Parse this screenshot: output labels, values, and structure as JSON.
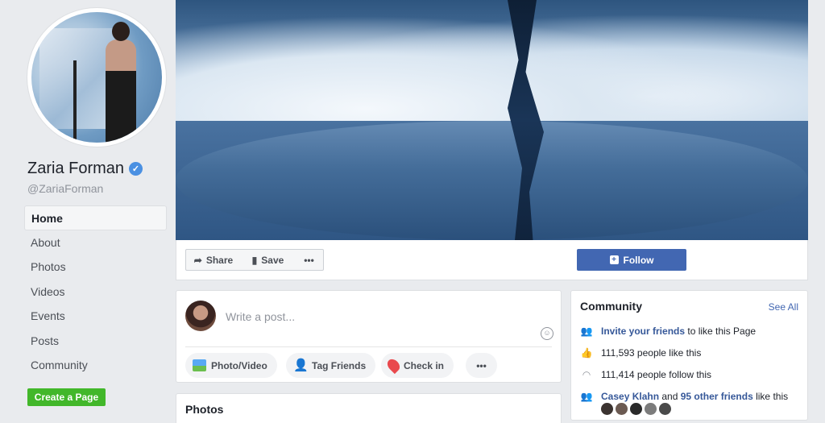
{
  "profile": {
    "name": "Zaria Forman",
    "handle": "@ZariaForman"
  },
  "nav": {
    "items": [
      {
        "label": "Home"
      },
      {
        "label": "About"
      },
      {
        "label": "Photos"
      },
      {
        "label": "Videos"
      },
      {
        "label": "Events"
      },
      {
        "label": "Posts"
      },
      {
        "label": "Community"
      }
    ],
    "active": "Home"
  },
  "create_page_label": "Create a Page",
  "actions": {
    "share_label": "Share",
    "save_label": "Save",
    "more_label": "•••",
    "follow_label": "Follow"
  },
  "composer": {
    "placeholder": "Write a post...",
    "photo_video_label": "Photo/Video",
    "tag_friends_label": "Tag Friends",
    "check_in_label": "Check in",
    "more_label": "•••"
  },
  "photos_card": {
    "title": "Photos"
  },
  "community": {
    "title": "Community",
    "see_all": "See All",
    "invite_link": "Invite your friends",
    "invite_rest": " to like this Page",
    "likes": "111,593 people like this",
    "follows": "111,414 people follow this",
    "friend_name": "Casey Klahn",
    "friend_and": " and ",
    "other_friends": "95 other friends",
    "friend_rest": " like this"
  },
  "colors": {
    "brand": "#4267b2",
    "link": "#365899",
    "create_button": "#42b72a",
    "verified": "#4a90e2"
  },
  "icons": {
    "verified": "verified-badge-icon",
    "share": "share-arrow-icon",
    "save": "bookmark-icon",
    "follow": "follow-plus-icon",
    "emoji": "smiley-icon",
    "invite": "friends-icon",
    "likes": "thumbs-up-icon",
    "follows": "rss-icon",
    "friends": "friends-icon"
  }
}
